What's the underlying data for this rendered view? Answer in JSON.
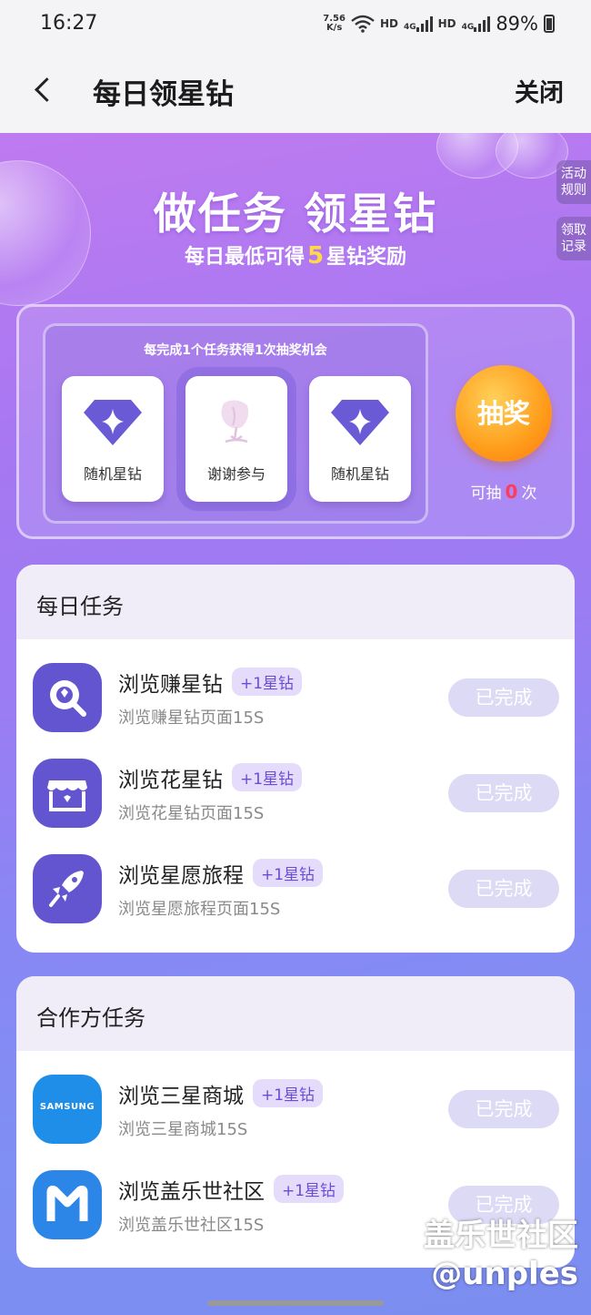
{
  "status_bar": {
    "time": "16:27",
    "net_speed_value": "7.56",
    "net_speed_unit": "K/s",
    "sim1": "HD",
    "sim1_net": "4G",
    "sim2": "HD",
    "sim2_net": "4G",
    "battery": "89%"
  },
  "header": {
    "title": "每日领星钻",
    "close_label": "关闭"
  },
  "hero": {
    "title": "做任务 领星钻",
    "sub_prefix": "每日最低可得",
    "sub_num": "5",
    "sub_suffix": "星钻奖励"
  },
  "side_tabs": {
    "rules": "活动规则",
    "records": "领取记录"
  },
  "lottery": {
    "hint": "每完成1个任务获得1次抽奖机会",
    "prizes": [
      {
        "label": "随机星钻",
        "icon": "diamond-icon"
      },
      {
        "label": "谢谢参与",
        "icon": "sad-flower-icon"
      },
      {
        "label": "随机星钻",
        "icon": "diamond-icon"
      }
    ],
    "draw_label": "抽奖",
    "count_prefix": "可抽",
    "count": "0",
    "count_suffix": "次"
  },
  "daily": {
    "title": "每日任务",
    "tasks": [
      {
        "name": "浏览赚星钻",
        "badge": "+1星钻",
        "desc": "浏览赚星钻页面15S",
        "status": "已完成",
        "icon": "search-diamond-icon"
      },
      {
        "name": "浏览花星钻",
        "badge": "+1星钻",
        "desc": "浏览花星钻页面15S",
        "status": "已完成",
        "icon": "store-icon"
      },
      {
        "name": "浏览星愿旅程",
        "badge": "+1星钻",
        "desc": "浏览星愿旅程页面15S",
        "status": "已完成",
        "icon": "rocket-icon"
      }
    ]
  },
  "partner": {
    "title": "合作方任务",
    "tasks": [
      {
        "name": "浏览三星商城",
        "badge": "+1星钻",
        "desc": "浏览三星商城15S",
        "status": "已完成",
        "icon": "samsung-logo-icon",
        "logo_text": "SAMSUNG"
      },
      {
        "name": "浏览盖乐世社区",
        "badge": "+1星钻",
        "desc": "浏览盖乐世社区15S",
        "status": "已完成",
        "icon": "members-m-icon"
      }
    ]
  },
  "watermark": {
    "line1": "盖乐世社区",
    "line2": "@unples"
  },
  "colors": {
    "accent": "#6354cf",
    "badge_bg": "#e5dcfb",
    "done_btn": "#dcdaf5",
    "draw_btn": "#ff9c1a"
  }
}
